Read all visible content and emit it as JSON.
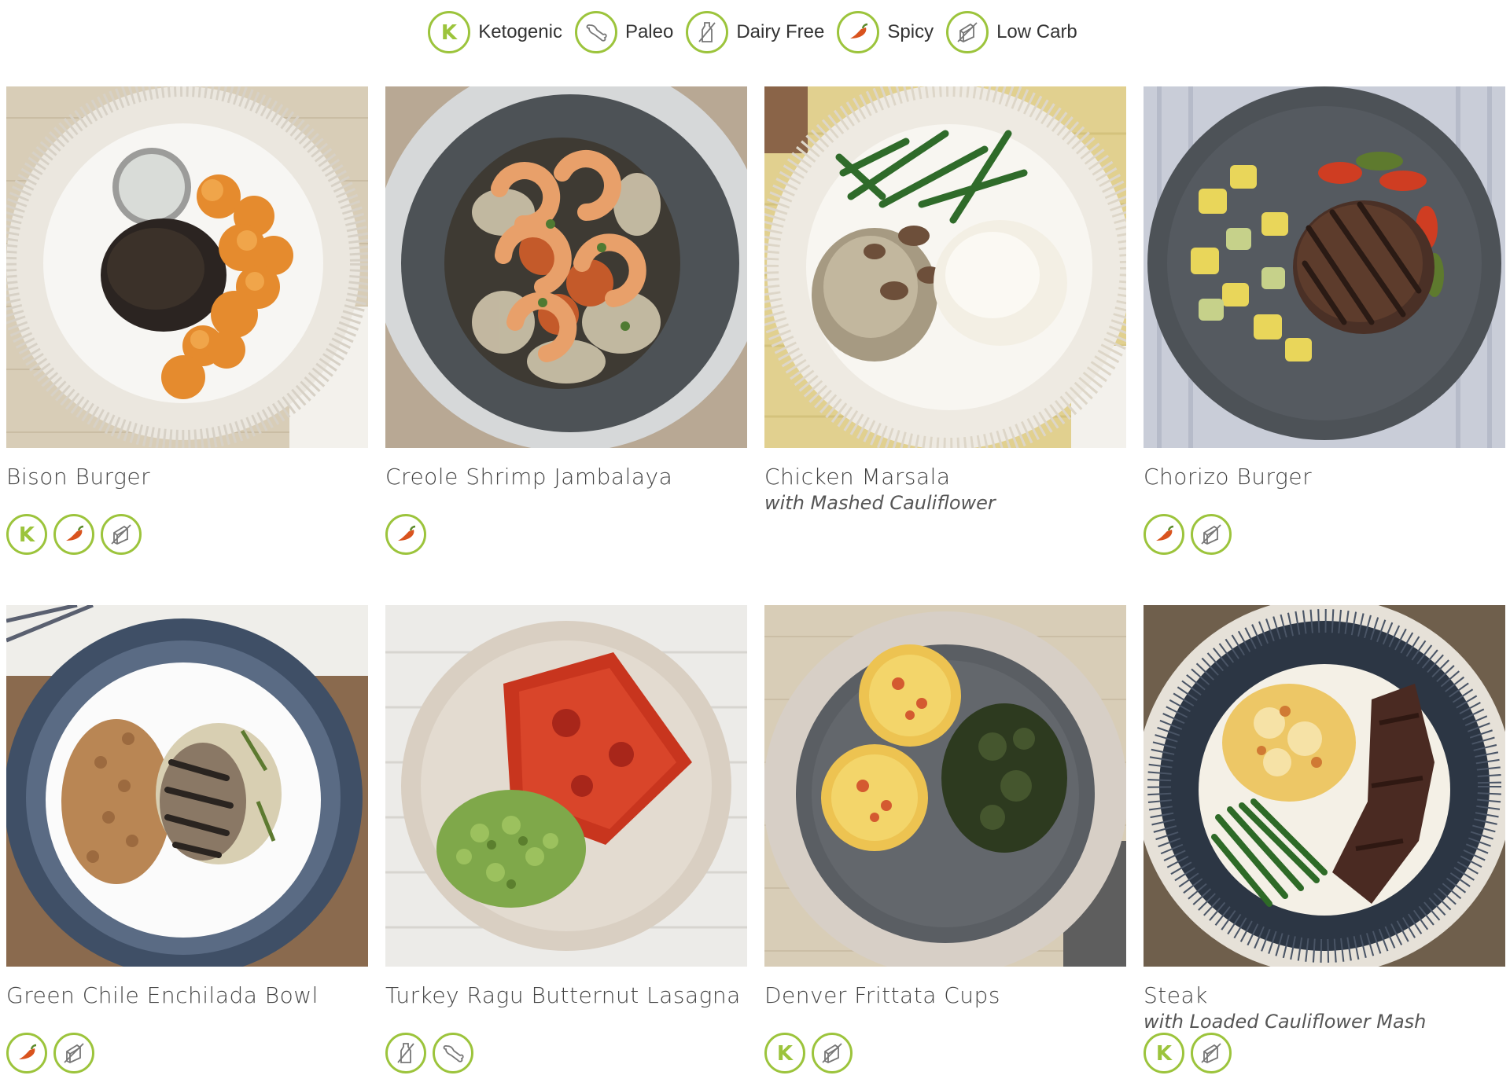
{
  "legend": [
    {
      "icon": "keto-icon",
      "label": "Ketogenic"
    },
    {
      "icon": "paleo-icon",
      "label": "Paleo"
    },
    {
      "icon": "dairy-free-icon",
      "label": "Dairy Free"
    },
    {
      "icon": "spicy-icon",
      "label": "Spicy"
    },
    {
      "icon": "low-carb-icon",
      "label": "Low Carb"
    }
  ],
  "colors": {
    "accent": "#9cc43c",
    "text": "#444444",
    "pepper": "#d9531e"
  },
  "meals": [
    {
      "name": "Bison Burger",
      "subtitle": "",
      "badges": [
        "keto-icon",
        "spicy-icon",
        "low-carb-icon"
      ]
    },
    {
      "name": "Creole Shrimp Jambalaya",
      "subtitle": "",
      "badges": [
        "spicy-icon"
      ]
    },
    {
      "name": "Chicken Marsala",
      "subtitle": "with Mashed Cauliflower",
      "badges": []
    },
    {
      "name": "Chorizo Burger",
      "subtitle": "",
      "badges": [
        "spicy-icon",
        "low-carb-icon"
      ]
    },
    {
      "name": "Green Chile Enchilada Bowl",
      "subtitle": "",
      "badges": [
        "spicy-icon",
        "low-carb-icon"
      ]
    },
    {
      "name": "Turkey Ragu Butternut Lasagna",
      "subtitle": "",
      "badges": [
        "dairy-free-icon",
        "paleo-icon"
      ]
    },
    {
      "name": "Denver Frittata Cups",
      "subtitle": "",
      "badges": [
        "keto-icon",
        "low-carb-icon"
      ]
    },
    {
      "name": "Steak",
      "subtitle": "with Loaded Cauliflower Mash",
      "badges": [
        "keto-icon",
        "low-carb-icon"
      ]
    }
  ]
}
